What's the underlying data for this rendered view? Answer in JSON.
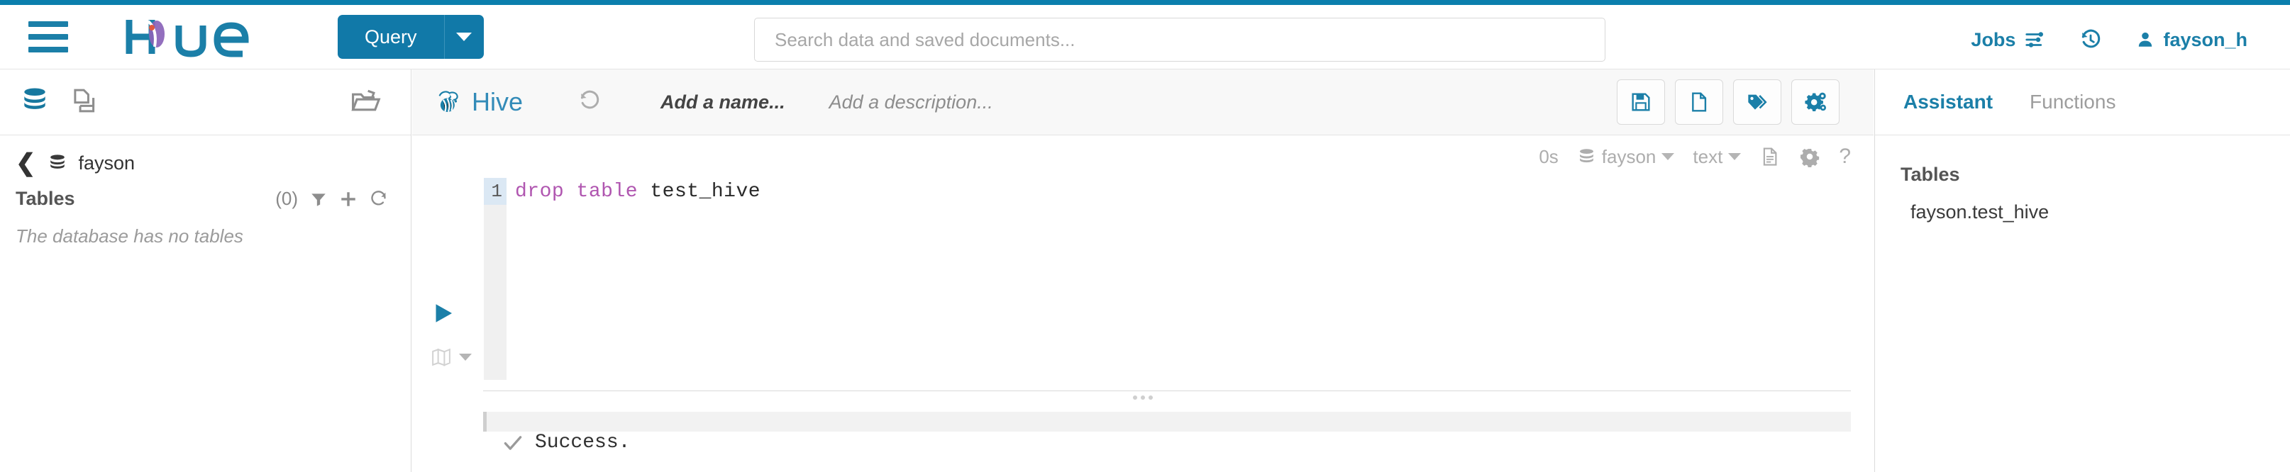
{
  "navbar": {
    "hamburger_icon": "hamburger-menu-icon",
    "logo_text": "hue",
    "query_button_label": "Query",
    "query_dropdown_icon": "caret-down-icon",
    "search_placeholder": "Search data and saved documents...",
    "jobs_label": "Jobs",
    "jobs_icon": "sliders-icon",
    "history_icon": "history-clock-icon",
    "user_icon": "user-icon",
    "user_name": "fayson_h",
    "accent_color": "#1B7FA8",
    "top_bar_color": "#0B7FAD"
  },
  "left_sidebar": {
    "toolbar_icons": [
      "database-icon",
      "documents-icon",
      "open-folder-icon"
    ],
    "breadcrumb": {
      "back_icon": "chevron-left-icon",
      "db_icon": "database-icon",
      "db_name": "fayson"
    },
    "tables_label": "Tables",
    "tables_count": "(0)",
    "filter_icon": "filter-icon",
    "add_icon": "plus-icon",
    "refresh_icon": "refresh-icon",
    "empty_message": "The database has no tables"
  },
  "editor": {
    "engine_icon": "hive-bee-icon",
    "engine_name": "Hive",
    "undo_icon": "history-undo-icon",
    "name_placeholder": "Add a name...",
    "description_placeholder": "Add a description...",
    "header_buttons": [
      {
        "name": "save-button",
        "icon": "floppy-save-icon"
      },
      {
        "name": "new-query-button",
        "icon": "file-page-icon"
      },
      {
        "name": "tags-button",
        "icon": "tags-icon"
      },
      {
        "name": "settings-button",
        "icon": "gears-icon"
      }
    ],
    "subbar": {
      "elapsed_time": "0s",
      "database_icon": "database-icon",
      "database_name": "fayson",
      "database_caret": "caret-down-icon",
      "result_format": "text",
      "format_caret": "caret-down-icon",
      "log_icon": "document-lines-icon",
      "settings_icon": "gear-icon",
      "help_icon": "question-mark-icon"
    },
    "run_button_icon": "play-triangle-icon",
    "map_button_icon": "map-icon",
    "map_caret_icon": "caret-down-icon",
    "line_number": "1",
    "code": {
      "keyword_1": "drop",
      "keyword_2": "table",
      "identifier": "test_hive",
      "full_text": "drop table test_hive"
    },
    "resize_grip_icon": "drag-grip-icon",
    "result": {
      "status_icon": "check-mark-icon",
      "message": "Success."
    }
  },
  "right_panel": {
    "tabs": [
      {
        "label": "Assistant",
        "active": true
      },
      {
        "label": "Functions",
        "active": false
      }
    ],
    "section_title": "Tables",
    "items": [
      "fayson.test_hive"
    ]
  }
}
